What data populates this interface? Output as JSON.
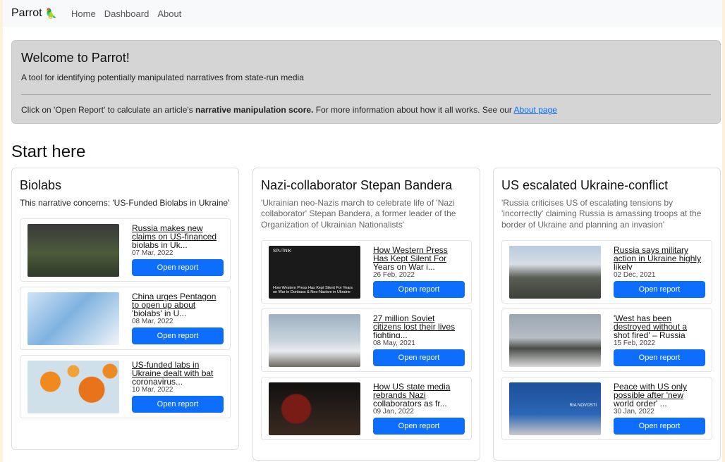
{
  "nav": {
    "brand": "Parrot",
    "brand_icon": "parrot-icon",
    "links": [
      "Home",
      "Dashboard",
      "About"
    ]
  },
  "hero": {
    "title": "Welcome to Parrot!",
    "lead": "A tool for identifying potentially manipulated narratives from state-run media",
    "info_prefix": "Click on 'Open Report' to calculate an article's ",
    "info_bold": "narrative manipulation score.",
    "info_suffix": " For more information about how it all works. See our ",
    "info_link": "About page"
  },
  "start_title": "Start here",
  "button_label": "Open report",
  "cards": [
    {
      "title": "Biolabs",
      "concern": "This narrative concerns: 'US-Funded Biolabs in Ukraine'",
      "articles": [
        {
          "title": "Russia makes new claims on US-financed biolabs in Uk...",
          "date": "07 Mar, 2022"
        },
        {
          "title": "China urges Pentagon to open up about 'biolabs' in U...",
          "date": "08 Mar, 2022"
        },
        {
          "title": "US-funded labs in Ukraine dealt with bat coronavirus...",
          "date": "10 Mar, 2022"
        }
      ]
    },
    {
      "title": "Nazi-collaborator Stepan Bandera",
      "concern": "'Ukrainian neo-Nazis march to celebrate life of 'Nazi collaborator' Stepan Bandera, a former leader of the Organization of Ukrainian Nationalists'",
      "articles": [
        {
          "title": "How Western Press Has Kept Silent For Years on War i...",
          "date": "26 Feb, 2022",
          "thumb_brand": "SPUTNIK",
          "thumb_caption": "How Western Press Has Kept Silent For Years on War in Donbass & Neo-Nazism in Ukraine"
        },
        {
          "title": "27 million Soviet citizens lost their lives fighting...",
          "date": "08 May, 2021"
        },
        {
          "title": "How US state media rebrands Nazi collaborators as fr...",
          "date": "09 Jan, 2022"
        }
      ]
    },
    {
      "title": "US escalated Ukraine-conflict",
      "concern": "'Russia criticises US of escalating tensions by 'incorrectly' claiming Russia is amassing troops at the border of Ukraine and planning an invasion'",
      "articles": [
        {
          "title": "Russia says military action in Ukraine highly likely",
          "date": "02 Dec, 2021"
        },
        {
          "title": "'West has been destroyed without a shot fired' – Russia",
          "date": "15 Feb, 2022"
        },
        {
          "title": "Peace with US only possible after 'new world order' ...",
          "date": "30 Jan, 2022",
          "thumb_brand": "RIA NOVOSTI"
        }
      ]
    }
  ]
}
